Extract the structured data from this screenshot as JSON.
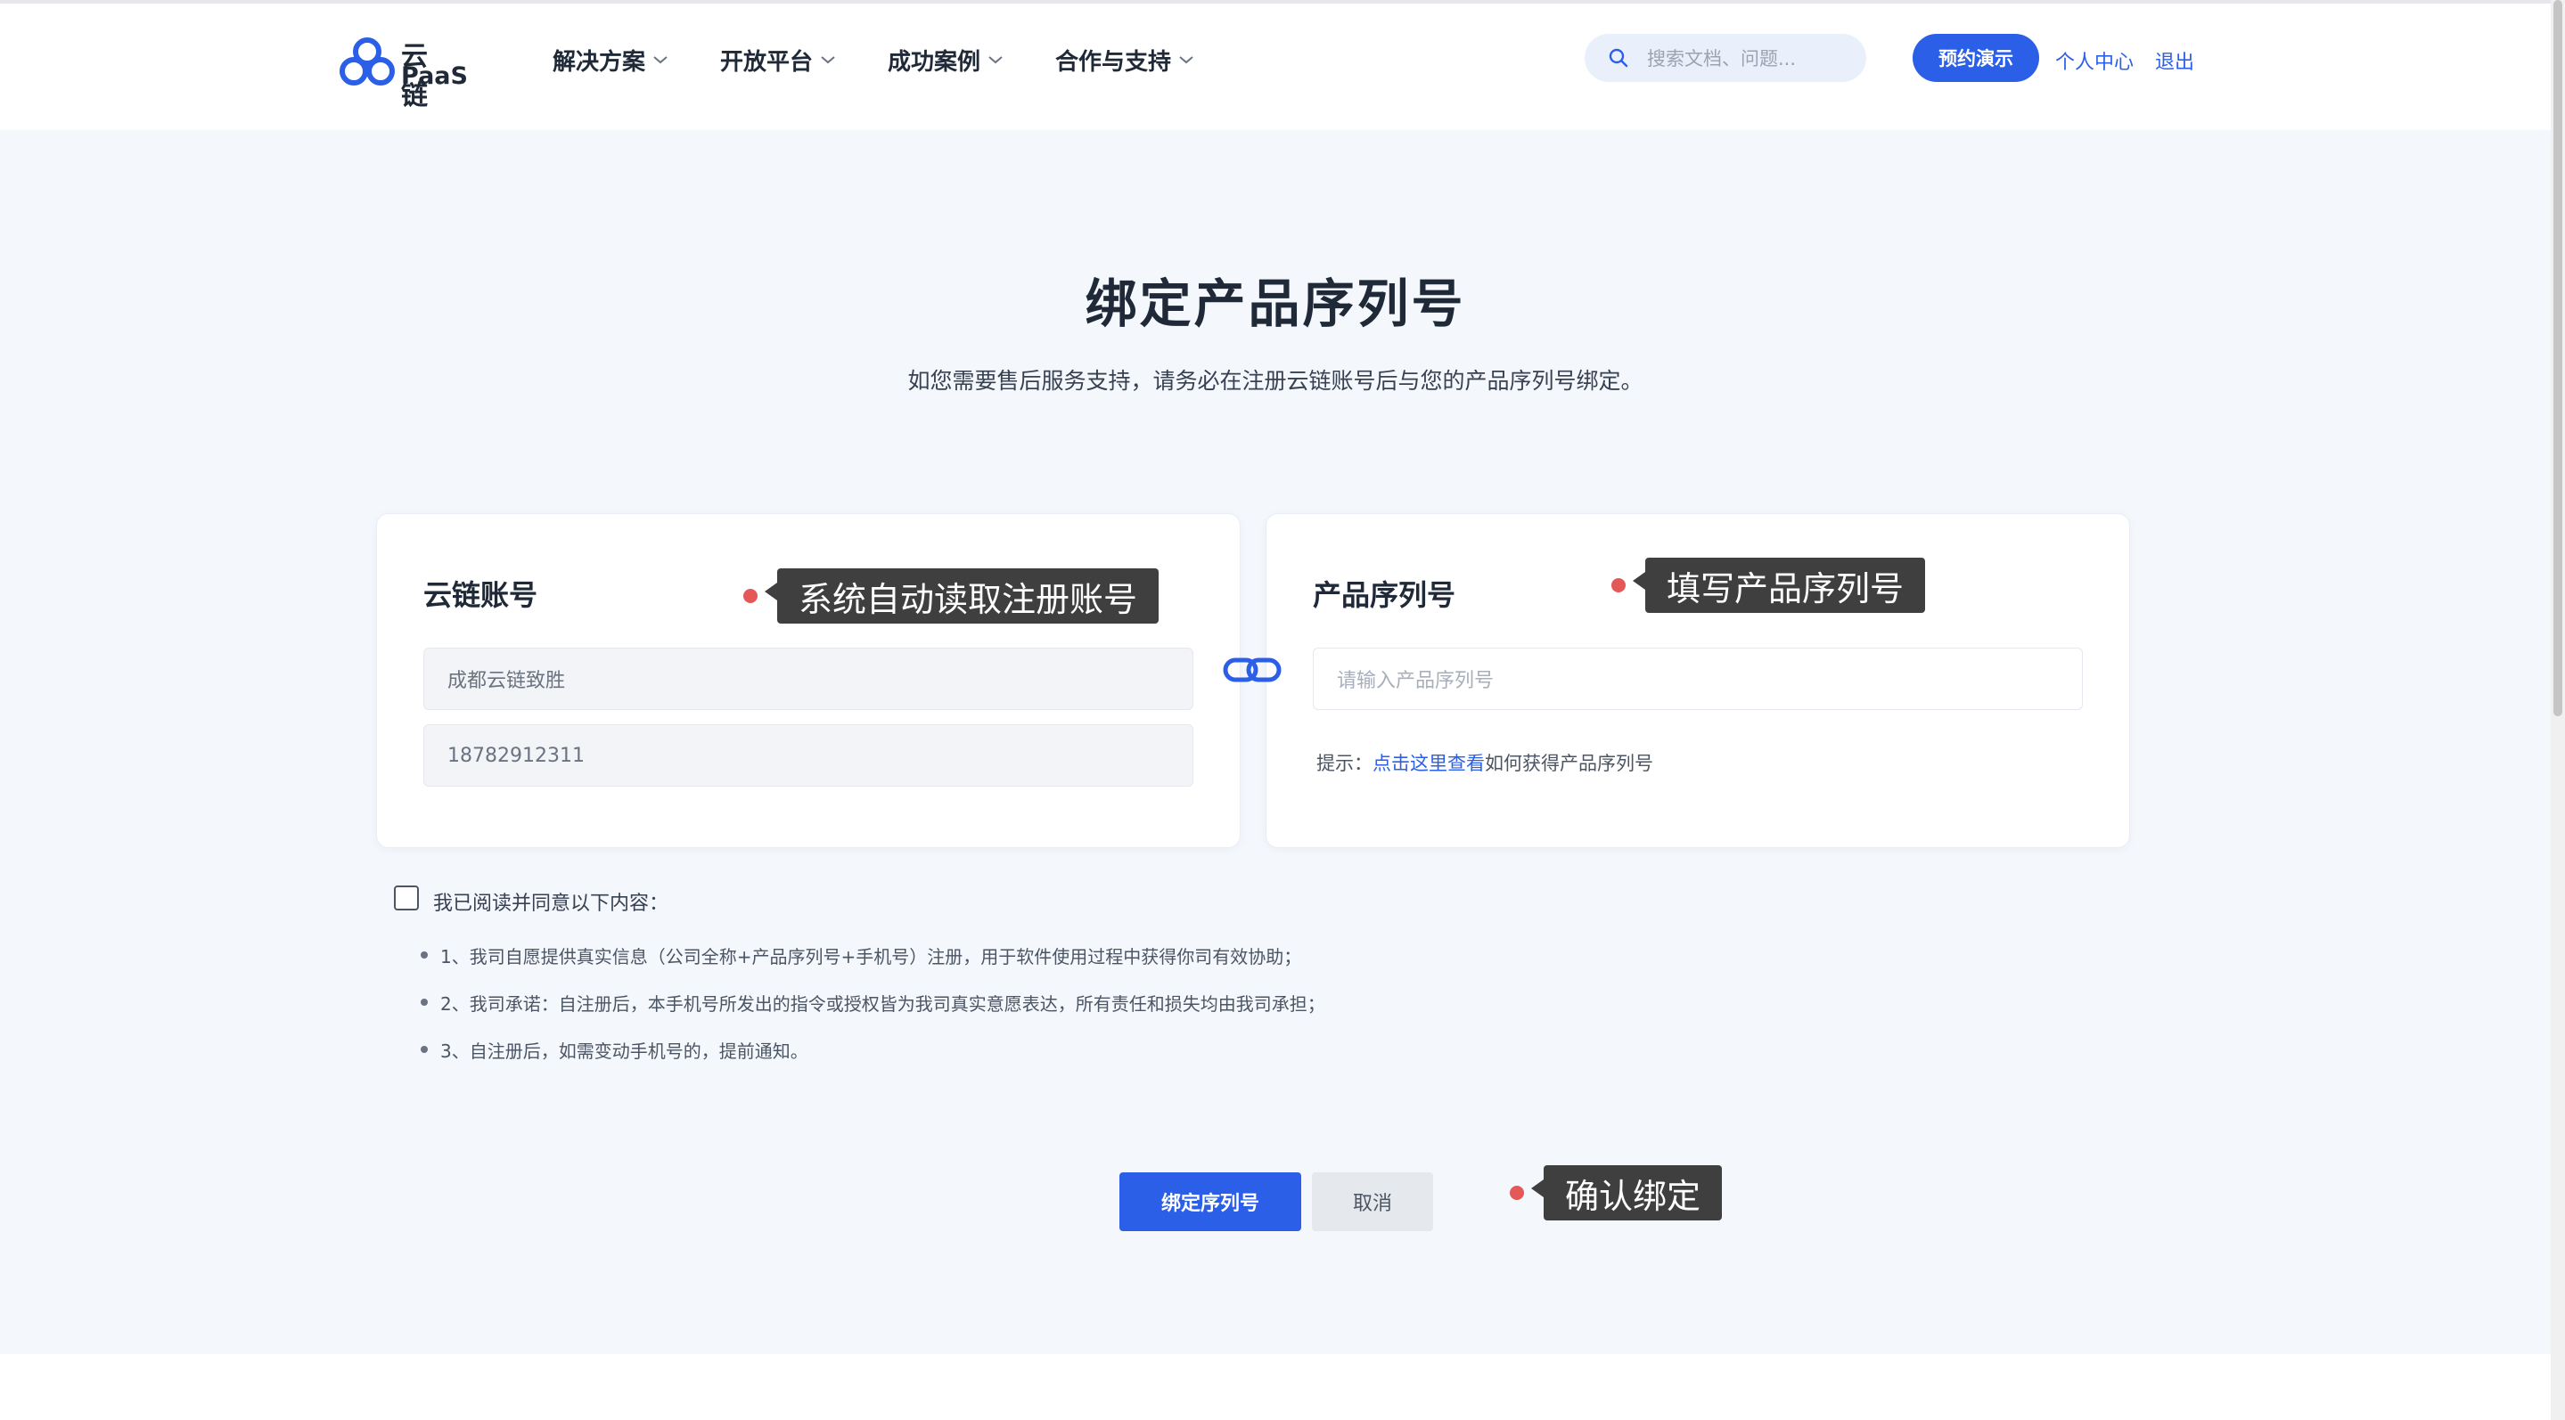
{
  "header": {
    "logo_cn": "云链",
    "logo_en": "PaaS",
    "nav": [
      {
        "label": "解决方案"
      },
      {
        "label": "开放平台"
      },
      {
        "label": "成功案例"
      },
      {
        "label": "合作与支持"
      }
    ],
    "search_placeholder": "搜索文档、问题...",
    "demo_button": "预约演示",
    "personal_center": "个人中心",
    "logout": "退出"
  },
  "page": {
    "title": "绑定产品序列号",
    "subtitle": "如您需要售后服务支持，请务必在注册云链账号后与您的产品序列号绑定。"
  },
  "account_card": {
    "title": "云链账号",
    "company": "成都云链致胜",
    "phone": "18782912311",
    "annotation": "系统自动读取注册账号"
  },
  "serial_card": {
    "title": "产品序列号",
    "placeholder": "请输入产品序列号",
    "hint_prefix": "提示：",
    "hint_link": "点击这里查看",
    "hint_suffix": "如何获得产品序列号",
    "annotation": "填写产品序列号"
  },
  "agreement": {
    "label": "我已阅读并同意以下内容：",
    "terms": [
      "1、我司自愿提供真实信息（公司全称+产品序列号+手机号）注册，用于软件使用过程中获得你司有效协助；",
      "2、我司承诺：自注册后，本手机号所发出的指令或授权皆为我司真实意愿表达，所有责任和损失均由我司承担；",
      "3、自注册后，如需变动手机号的，提前通知。"
    ]
  },
  "actions": {
    "bind_button": "绑定序列号",
    "cancel_button": "取消",
    "annotation": "确认绑定"
  },
  "colors": {
    "brand": "#2b5fe8",
    "background": "#f4f7fc",
    "annotation_dot": "#e45858"
  }
}
